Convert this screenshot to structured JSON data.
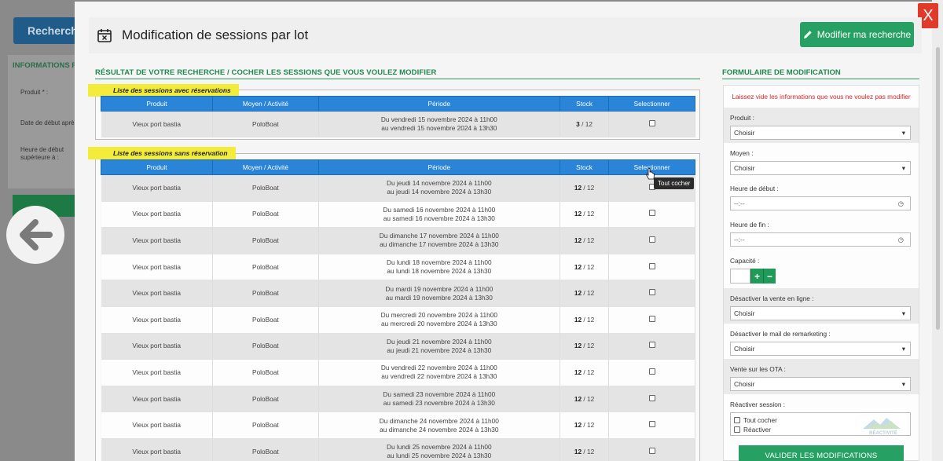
{
  "background": {
    "search_button_label": "Recherche",
    "panel_title": "INFORMATIONS PRINCIPALES",
    "labels": [
      "Produit * :",
      "Date de début après le :",
      "Heure de début supérieure à :"
    ]
  },
  "modal": {
    "title": "Modification de sessions par lot",
    "modify_button": "Modifier ma recherche",
    "close_label": "X"
  },
  "results": {
    "title": "RÉSULTAT DE VOTRE RECHERCHE / COCHER LES SESSIONS QUE VOUS VOULEZ MODIFIER",
    "with_reservations": {
      "legend": "Liste des sessions avec réservations",
      "headers": [
        "Produit",
        "Moyen / Activité",
        "Période",
        "Stock",
        "Selectionner"
      ],
      "rows": [
        {
          "produit": "Vieux port bastia",
          "moyen": "PoloBoat",
          "periode_1": "Du vendredi 15 novembre 2024 à 11h00",
          "periode_2": "au vendredi 15 novembre 2024 à 13h30",
          "stock_used": "3",
          "stock_total": "/ 12"
        }
      ]
    },
    "without_reservations": {
      "legend": "Liste des sessions sans réservation",
      "headers": [
        "Produit",
        "Moyen / Activité",
        "Période",
        "Stock",
        "Selectionner"
      ],
      "tooltip": "Tout cocher",
      "rows": [
        {
          "produit": "Vieux port bastia",
          "moyen": "PoloBoat",
          "periode_1": "Du jeudi 14 novembre 2024 à 11h00",
          "periode_2": "au jeudi 14 novembre 2024 à 13h30",
          "stock_used": "12",
          "stock_total": "/ 12"
        },
        {
          "produit": "Vieux port bastia",
          "moyen": "PoloBoat",
          "periode_1": "Du samedi 16 novembre 2024 à 11h00",
          "periode_2": "au samedi 16 novembre 2024 à 13h30",
          "stock_used": "12",
          "stock_total": "/ 12"
        },
        {
          "produit": "Vieux port bastia",
          "moyen": "PoloBoat",
          "periode_1": "Du dimanche 17 novembre 2024 à 11h00",
          "periode_2": "au dimanche 17 novembre 2024 à 13h30",
          "stock_used": "12",
          "stock_total": "/ 12"
        },
        {
          "produit": "Vieux port bastia",
          "moyen": "PoloBoat",
          "periode_1": "Du lundi 18 novembre 2024 à 11h00",
          "periode_2": "au lundi 18 novembre 2024 à 13h30",
          "stock_used": "12",
          "stock_total": "/ 12"
        },
        {
          "produit": "Vieux port bastia",
          "moyen": "PoloBoat",
          "periode_1": "Du mardi 19 novembre 2024 à 11h00",
          "periode_2": "au mardi 19 novembre 2024 à 13h30",
          "stock_used": "12",
          "stock_total": "/ 12"
        },
        {
          "produit": "Vieux port bastia",
          "moyen": "PoloBoat",
          "periode_1": "Du mercredi 20 novembre 2024 à 11h00",
          "periode_2": "au mercredi 20 novembre 2024 à 13h30",
          "stock_used": "12",
          "stock_total": "/ 12"
        },
        {
          "produit": "Vieux port bastia",
          "moyen": "PoloBoat",
          "periode_1": "Du jeudi 21 novembre 2024 à 11h00",
          "periode_2": "au jeudi 21 novembre 2024 à 13h30",
          "stock_used": "12",
          "stock_total": "/ 12"
        },
        {
          "produit": "Vieux port bastia",
          "moyen": "PoloBoat",
          "periode_1": "Du vendredi 22 novembre 2024 à 11h00",
          "periode_2": "au vendredi 22 novembre 2024 à 13h30",
          "stock_used": "12",
          "stock_total": "/ 12"
        },
        {
          "produit": "Vieux port bastia",
          "moyen": "PoloBoat",
          "periode_1": "Du samedi 23 novembre 2024 à 11h00",
          "periode_2": "au samedi 23 novembre 2024 à 13h30",
          "stock_used": "12",
          "stock_total": "/ 12"
        },
        {
          "produit": "Vieux port bastia",
          "moyen": "PoloBoat",
          "periode_1": "Du dimanche 24 novembre 2024 à 11h00",
          "periode_2": "au dimanche 24 novembre 2024 à 13h30",
          "stock_used": "12",
          "stock_total": "/ 12"
        },
        {
          "produit": "Vieux port bastia",
          "moyen": "PoloBoat",
          "periode_1": "Du lundi 25 novembre 2024 à 11h00",
          "periode_2": "au lundi 25 novembre 2024 à 13h30",
          "stock_used": "12",
          "stock_total": "/ 12"
        }
      ]
    }
  },
  "form": {
    "title": "FORMULAIRE DE MODIFICATION",
    "warning": "Laissez vide les informations que vous ne voulez pas modifier",
    "produit": {
      "label": "Produit :",
      "value": "Choisir"
    },
    "moyen": {
      "label": "Moyen :",
      "value": "Choisir"
    },
    "heure_debut": {
      "label": "Heure de début :",
      "value": "--:--"
    },
    "heure_fin": {
      "label": "Heure de fin :",
      "value": "--:--"
    },
    "capacite": {
      "label": "Capacité :",
      "plus": "+",
      "minus": "−"
    },
    "vente_en_ligne": {
      "label": "Désactiver la vente en ligne :",
      "value": "Choisir"
    },
    "mail_remarketing": {
      "label": "Désactiver le mail de remarketing :",
      "value": "Choisir"
    },
    "vente_ota": {
      "label": "Vente sur les OTA :",
      "value": "Choisir"
    },
    "reactiver": {
      "label": "Réactiver session :",
      "tout_cocher": "Tout cocher",
      "reactiver": "Réactiver"
    },
    "watermark": "RÉACTIVITÉ",
    "validate_button": "VALIDER LES MODIFICATIONS"
  }
}
